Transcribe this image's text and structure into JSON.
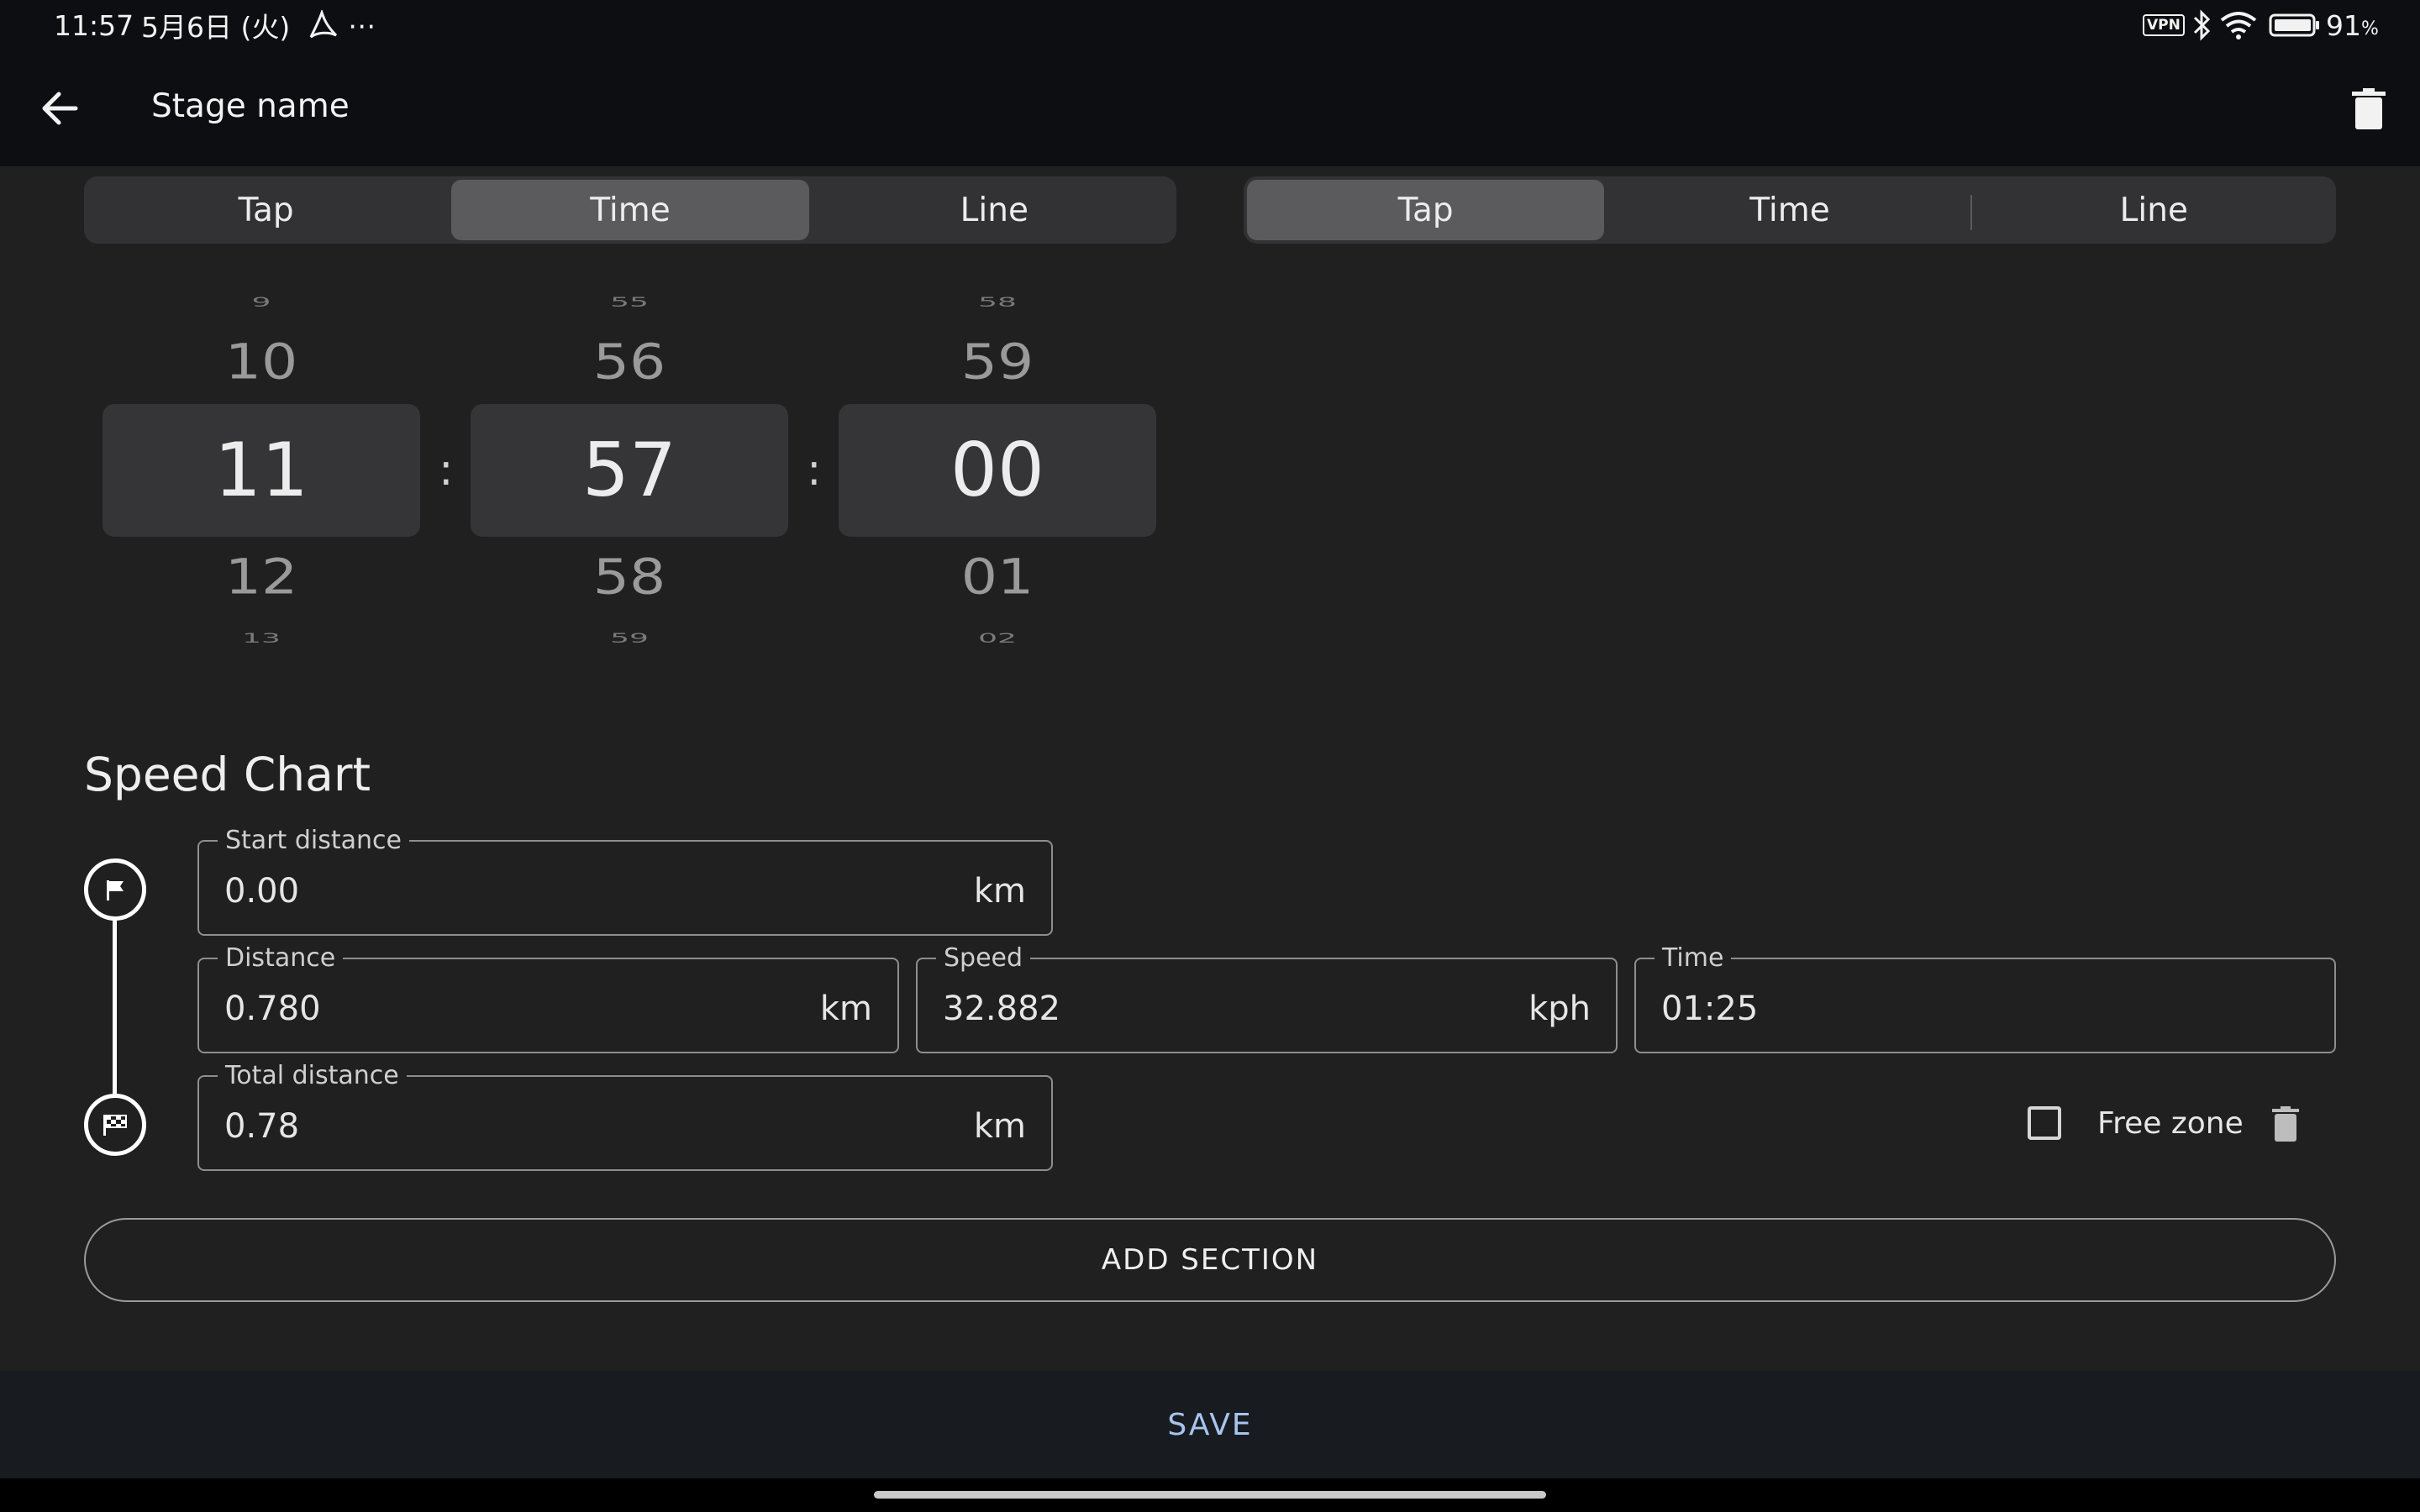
{
  "status_bar": {
    "time": "11:57",
    "date": "5月6日 (火)",
    "extra": "⋯",
    "vpn": "VPN",
    "battery": "91",
    "battery_unit": "%"
  },
  "app_bar": {
    "back_icon": "arrow-left-icon",
    "title": "Stage name",
    "delete_icon": "trash-icon"
  },
  "start_mode": {
    "options": [
      "Tap",
      "Time",
      "Line"
    ],
    "selected": "Time"
  },
  "finish_mode": {
    "options": [
      "Tap",
      "Time",
      "Line"
    ],
    "selected": "Tap"
  },
  "time_picker": {
    "separator": ":",
    "hours": {
      "prev2": "9",
      "prev1": "10",
      "value": "11",
      "next1": "12",
      "next2": "13"
    },
    "minutes": {
      "prev2": "55",
      "prev1": "56",
      "value": "57",
      "next1": "58",
      "next2": "59"
    },
    "seconds": {
      "prev2": "58",
      "prev1": "59",
      "value": "00",
      "next1": "01",
      "next2": "02"
    }
  },
  "speed_chart": {
    "title": "Speed Chart",
    "start_distance": {
      "label": "Start distance",
      "value": "0.00",
      "unit": "km"
    },
    "distance": {
      "label": "Distance",
      "value": "0.780",
      "unit": "km"
    },
    "speed": {
      "label": "Speed",
      "value": "32.882",
      "unit": "kph"
    },
    "time": {
      "label": "Time",
      "value": "01:25"
    },
    "total_distance": {
      "label": "Total distance",
      "value": "0.78",
      "unit": "km"
    },
    "free_zone": {
      "label": "Free zone",
      "checked": false
    },
    "add_section_label": "ADD SECTION"
  },
  "bottom": {
    "save_label": "SAVE"
  },
  "colors": {
    "background": "#202020",
    "bar": "#0c0e12",
    "accent": "#a8c4ec"
  }
}
